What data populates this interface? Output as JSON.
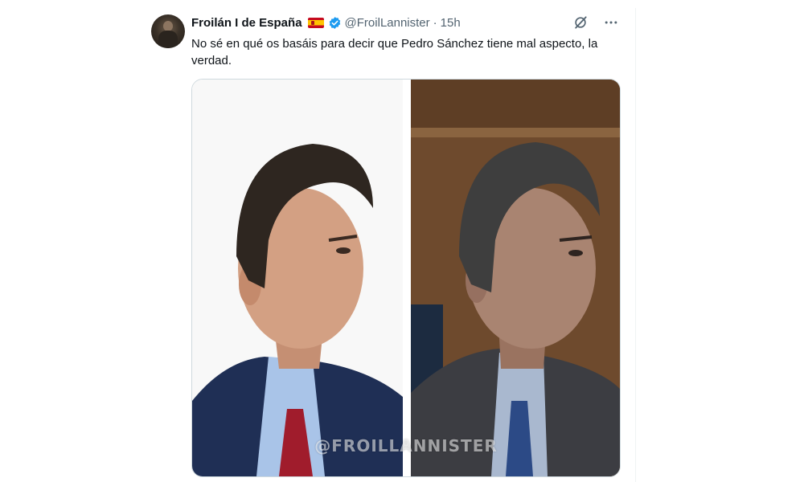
{
  "tweet": {
    "author": {
      "display_name": "Froilán I de España",
      "flag_icon": "spain-flag-icon",
      "verified_icon": "verified-badge-icon",
      "handle": "@FroilLannister",
      "separator": "·",
      "time": "15h"
    },
    "text": "No sé en qué os basáis para decir que Pedro Sánchez tiene mal aspecto, la verdad.",
    "actions": {
      "grok_icon": "grok-icon",
      "more_icon": "more-options-icon"
    },
    "media": {
      "watermark": "@FROILLANNISTER",
      "images": [
        "portrait-left-photo",
        "portrait-right-photo"
      ]
    }
  },
  "colors": {
    "text_primary": "#0f1419",
    "text_secondary": "#536471",
    "verified_blue": "#1d9bf0",
    "border": "#cfd9de"
  }
}
